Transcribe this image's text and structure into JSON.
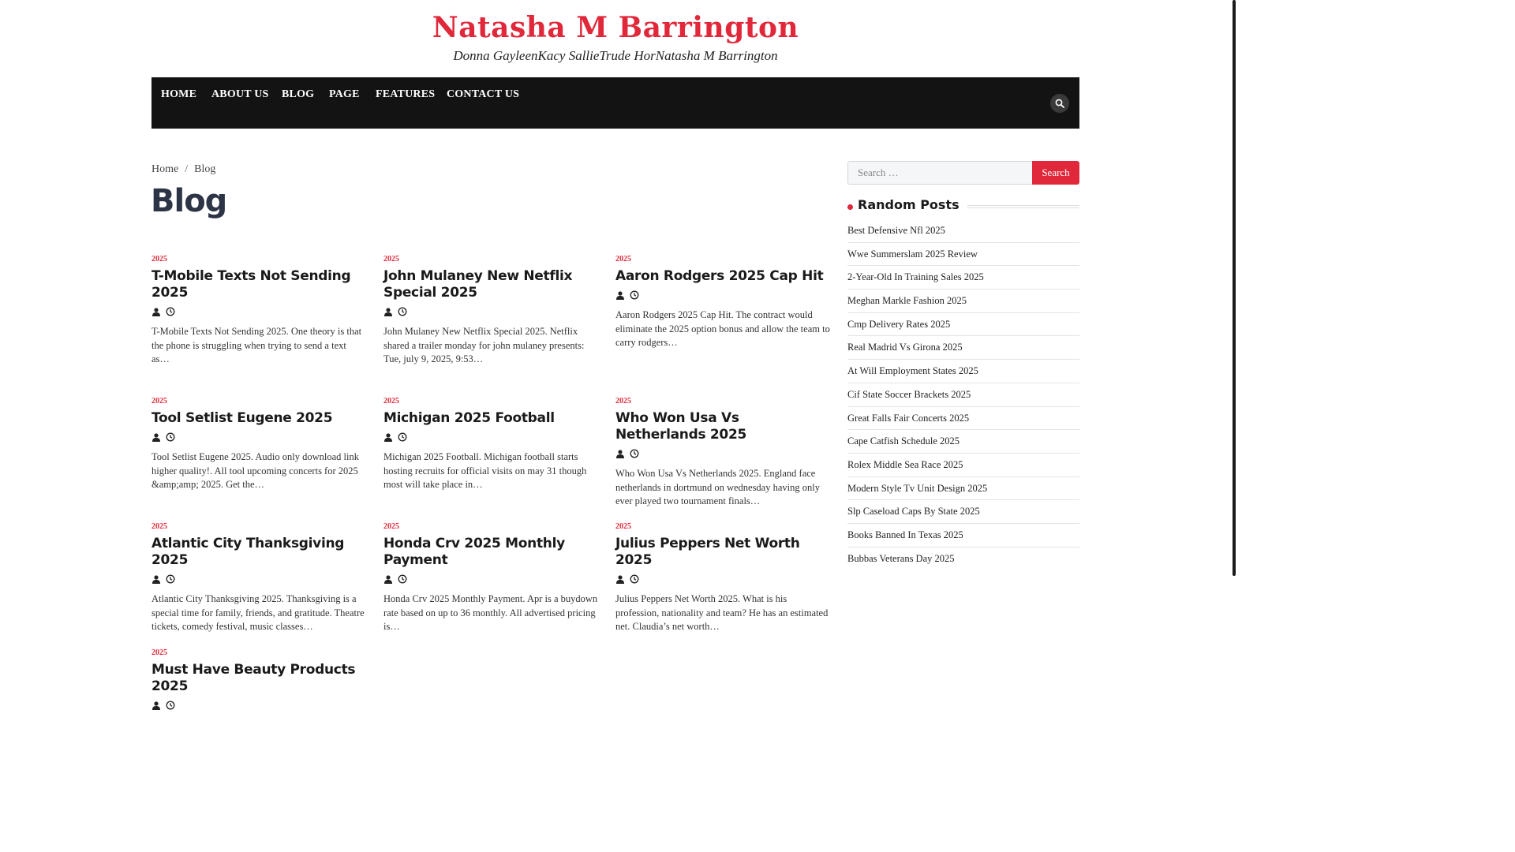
{
  "site": {
    "title": "Natasha M Barrington",
    "tagline": "Donna GayleenKacy SallieTrude HorNatasha M Barrington"
  },
  "nav": {
    "items": [
      "HOME",
      "ABOUT US",
      "BLOG",
      "PAGE",
      "FEATURES",
      "CONTACT US"
    ],
    "search_icon": "search-icon"
  },
  "breadcrumb": {
    "home": "Home",
    "separator": "/",
    "current": "Blog"
  },
  "page": {
    "title": "Blog"
  },
  "posts": [
    {
      "category": "2025",
      "title": "T-Mobile Texts Not Sending 2025",
      "excerpt": "T-Mobile Texts Not Sending 2025. One theory is that the phone is struggling when trying to send a text as…"
    },
    {
      "category": "2025",
      "title": "John Mulaney New Netflix Special 2025",
      "excerpt": "John Mulaney New Netflix Special 2025. Netflix shared a trailer monday for john mulaney presents: Tue, july 9, 2025, 9:53…"
    },
    {
      "category": "2025",
      "title": "Aaron Rodgers 2025 Cap Hit",
      "excerpt": "Aaron Rodgers 2025 Cap Hit. The contract would eliminate the 2025 option bonus and allow the team to carry rodgers…"
    },
    {
      "category": "2025",
      "title": "Tool Setlist Eugene 2025",
      "excerpt": "Tool Setlist Eugene 2025. Audio only download link higher quality!. All tool upcoming concerts for 2025 &amp;amp; 2025. Get the…"
    },
    {
      "category": "2025",
      "title": "Michigan 2025 Football",
      "excerpt": "Michigan 2025 Football. Michigan football starts hosting recruits for official visits on may 31 though most will take place in…"
    },
    {
      "category": "2025",
      "title": "Who Won Usa Vs Netherlands 2025",
      "excerpt": "Who Won Usa Vs Netherlands 2025. England face netherlands in dortmund on wednesday having only ever played two tournament finals…"
    },
    {
      "category": "2025",
      "title": "Atlantic City Thanksgiving 2025",
      "excerpt": "Atlantic City Thanksgiving 2025. Thanksgiving is a special time for family, friends, and gratitude. Theatre tickets, comedy festival, music classes…"
    },
    {
      "category": "2025",
      "title": "Honda Crv 2025 Monthly Payment",
      "excerpt": "Honda Crv 2025 Monthly Payment. Apr is a buydown rate based on up to 36 monthly. All advertised pricing is…"
    },
    {
      "category": "2025",
      "title": "Julius Peppers Net Worth 2025",
      "excerpt": "Julius Peppers Net Worth 2025. What is his profession, nationality and team? He has an estimated net. Claudia’s net worth…"
    },
    {
      "category": "2025",
      "title": "Must Have Beauty Products 2025",
      "excerpt": ""
    }
  ],
  "sidebar": {
    "search": {
      "placeholder": "Search …",
      "button": "Search"
    },
    "random_posts": {
      "title": "Random Posts",
      "items": [
        "Best Defensive Nfl 2025",
        "Wwe Summerslam 2025 Review",
        "2-Year-Old In Training Sales 2025",
        "Meghan Markle Fashion 2025",
        "Cmp Delivery Rates 2025",
        "Real Madrid Vs Girona 2025",
        "At Will Employment States 2025",
        "Cif State Soccer Brackets 2025",
        "Great Falls Fair Concerts 2025",
        "Cape Catfish Schedule 2025",
        "Rolex Middle Sea Race 2025",
        "Modern Style Tv Unit Design 2025",
        "Slp Caseload Caps By State 2025",
        "Books Banned In Texas 2025",
        "Bubbas Veterans Day 2025"
      ]
    }
  },
  "colors": {
    "accent": "#e0283a",
    "nav_bg": "#131313",
    "title_dark": "#2c3446"
  }
}
